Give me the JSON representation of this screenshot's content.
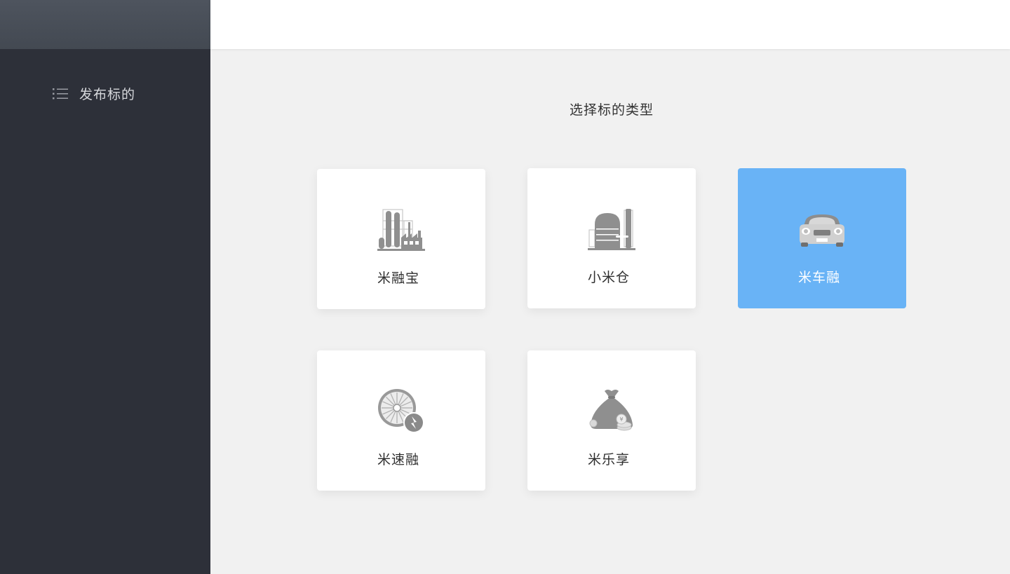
{
  "sidebar": {
    "nav": [
      {
        "label": "发布标的",
        "icon": "list-icon"
      }
    ]
  },
  "main": {
    "title": "选择标的类型",
    "cards": [
      {
        "label": "米融宝",
        "icon": "factory-icon",
        "selected": false
      },
      {
        "label": "小米仓",
        "icon": "warehouse-icon",
        "selected": false
      },
      {
        "label": "米车融",
        "icon": "car-icon",
        "selected": true
      },
      {
        "label": "米速融",
        "icon": "wheel-lightning-icon",
        "selected": false
      },
      {
        "label": "米乐享",
        "icon": "money-bag-icon",
        "selected": false
      }
    ]
  },
  "colors": {
    "sidebar_bg": "#2d3039",
    "selected_card": "#69b3f6",
    "content_bg": "#f1f1f1"
  }
}
